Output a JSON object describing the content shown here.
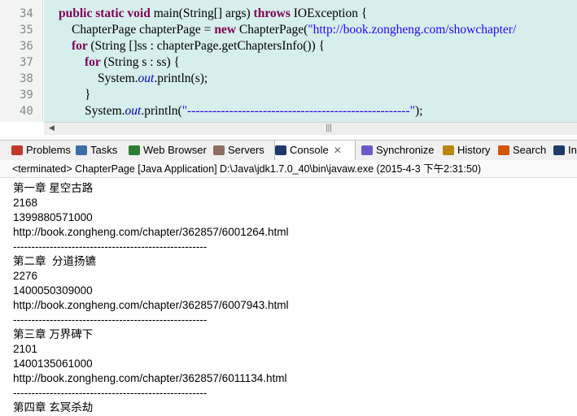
{
  "editor": {
    "line_numbers": [
      "34",
      "35",
      "36",
      "37",
      "38",
      "39",
      "40"
    ],
    "lines": [
      {
        "parts": [
          [
            "kw",
            "public static void "
          ],
          [
            "pl",
            "main(String[] args) "
          ],
          [
            "kw",
            "throws "
          ],
          [
            "pl",
            "IOException {"
          ]
        ]
      },
      {
        "parts": [
          [
            "pl",
            "ChapterPage chapterPage = "
          ],
          [
            "kw",
            "new "
          ],
          [
            "pl",
            "ChapterPage("
          ],
          [
            "str",
            "\"http://book.zongheng.com/showchapter/"
          ]
        ]
      },
      {
        "parts": [
          [
            "kw",
            "for "
          ],
          [
            "pl",
            "(String []ss : chapterPage.getChaptersInfo()) {"
          ]
        ]
      },
      {
        "parts": [
          [
            "kw",
            "for "
          ],
          [
            "pl",
            "(String s : ss) {"
          ]
        ]
      },
      {
        "parts": [
          [
            "pl",
            "System."
          ],
          [
            "fld",
            "out"
          ],
          [
            "pl",
            ".println(s);"
          ]
        ]
      },
      {
        "parts": [
          [
            "pl",
            "}"
          ]
        ]
      },
      {
        "parts": [
          [
            "pl",
            "System."
          ],
          [
            "fld",
            "out"
          ],
          [
            "pl",
            ".println("
          ],
          [
            "str",
            "\"-----------------------------------------------------\""
          ],
          [
            "pl",
            ");"
          ]
        ]
      }
    ]
  },
  "tabs": [
    {
      "label": "Problems",
      "icon": "problems-icon",
      "color": "#c0392b",
      "active": false
    },
    {
      "label": "Tasks",
      "icon": "tasks-icon",
      "color": "#3a6ea5",
      "active": false
    },
    {
      "label": "Web Browser",
      "icon": "globe-icon",
      "color": "#2e7d32",
      "active": false
    },
    {
      "label": "Servers",
      "icon": "servers-icon",
      "color": "#8d6e63",
      "active": false
    },
    {
      "label": "Console",
      "icon": "console-icon",
      "color": "#1f3a68",
      "active": true
    },
    {
      "label": "Synchronize",
      "icon": "synchronize-icon",
      "color": "#6a5acd",
      "active": false
    },
    {
      "label": "History",
      "icon": "history-icon",
      "color": "#b8860b",
      "active": false
    },
    {
      "label": "Search",
      "icon": "search-icon",
      "color": "#d35400",
      "active": false
    },
    {
      "label": "In",
      "icon": "javadoc-icon",
      "color": "#1f3a68",
      "active": false
    }
  ],
  "console": {
    "status": "<terminated> ChapterPage [Java Application] D:\\Java\\jdk1.7.0_40\\bin\\javaw.exe (2015-4-3 下午2:31:50)",
    "lines": [
      "第一章 星空古路",
      "2168",
      "1399880571000",
      "http://book.zongheng.com/chapter/362857/6001264.html",
      "-----------------------------------------------------",
      "第二章  分道扬镳",
      "2276",
      "1400050309000",
      "http://book.zongheng.com/chapter/362857/6007943.html",
      "-----------------------------------------------------",
      "第三章 万界碑下",
      "2101",
      "1400135061000",
      "http://book.zongheng.com/chapter/362857/6011134.html",
      "-----------------------------------------------------",
      "第四章 玄冥杀劫"
    ]
  },
  "colors": {
    "keyword": "#7f0055",
    "string": "#2a00ff",
    "field": "#0000c0",
    "editor_bg": "#d6eeec"
  }
}
